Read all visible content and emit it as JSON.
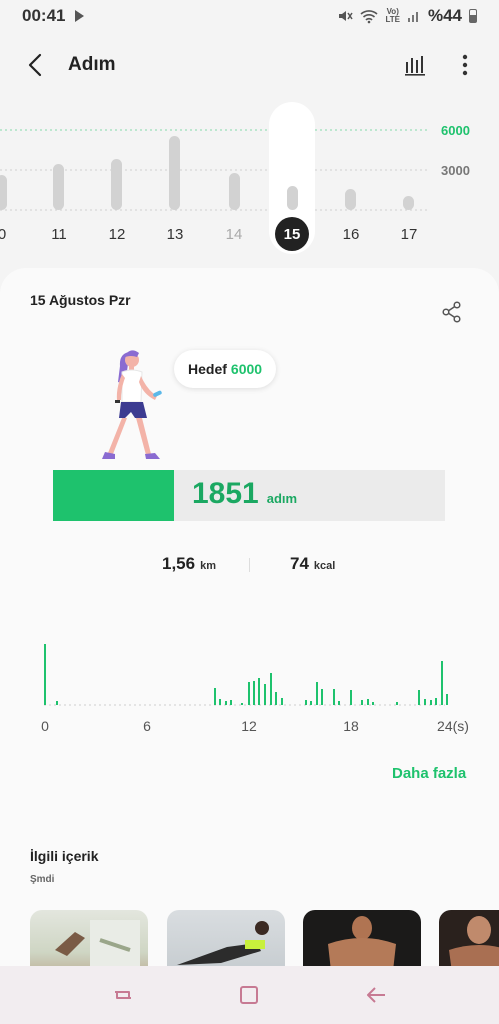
{
  "status_bar": {
    "time": "00:41",
    "lte_top": "Vo)",
    "lte_bottom": "LTE",
    "battery": "%44"
  },
  "header": {
    "title": "Adım",
    "icons": [
      "back-icon",
      "bar-chart-icon",
      "more-vert-icon"
    ]
  },
  "week_chart": {
    "goal_label": "6000",
    "mid_label": "3000",
    "days": [
      "0",
      "11",
      "12",
      "13",
      "14",
      "15",
      "16",
      "17"
    ],
    "selected_day": "15",
    "colors": {
      "goal": "#1ec26d",
      "bar": "#d2d2d2",
      "selected": "#222222"
    }
  },
  "day": {
    "date": "15 Ağustos Pzr",
    "goal_label": "Hedef",
    "goal_value": "6000",
    "steps_value": "1851",
    "steps_unit": "adım",
    "progress_fraction": 0.308,
    "distance_value": "1,56",
    "distance_unit": "km",
    "calorie_value": "74",
    "calorie_unit": "kcal"
  },
  "hourly_chart": {
    "x_labels": [
      "0",
      "6",
      "12",
      "18",
      "24(s)"
    ],
    "bar_color": "#1ec26d"
  },
  "more_label": "Daha fazla",
  "related": {
    "title": "İlgili içerik",
    "subtitle": "Şmdi",
    "thumbnails": [
      "workout-photo-1",
      "workout-photo-2",
      "workout-photo-3",
      "workout-photo-4"
    ]
  },
  "nav_bar": {
    "icons": [
      "recent-apps-icon",
      "home-icon",
      "back-nav-icon"
    ]
  }
}
